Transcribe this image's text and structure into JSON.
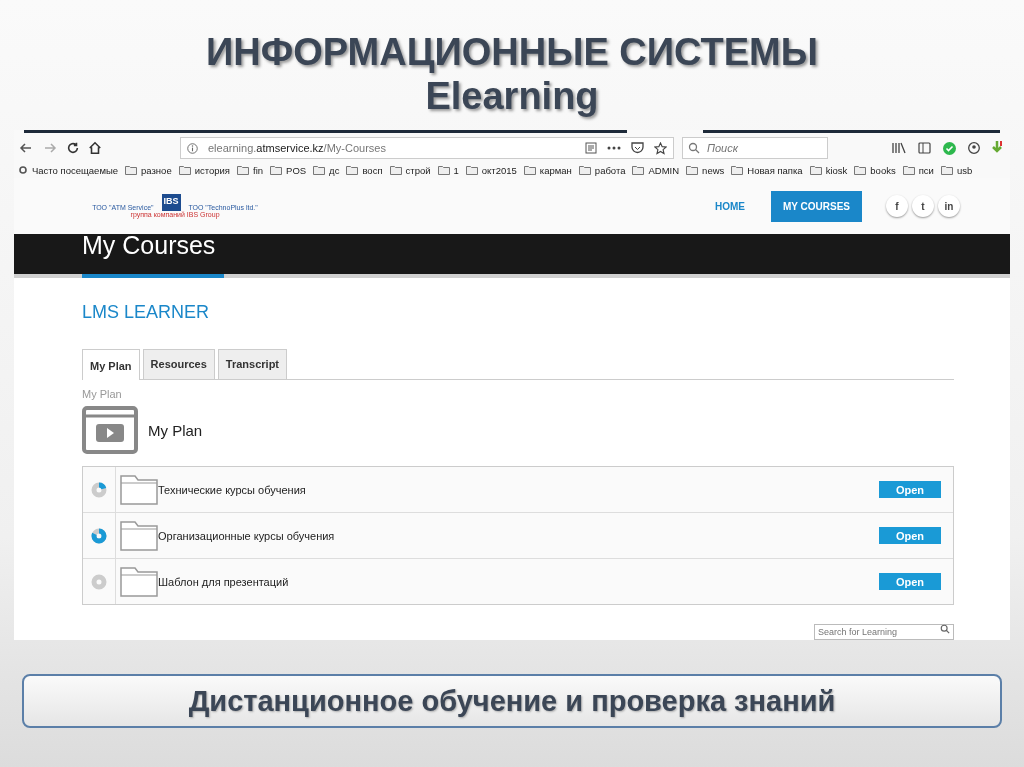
{
  "slide": {
    "title": "ИНФОРМАЦИОННЫЕ СИСТЕМЫ",
    "subtitle": "Elearning",
    "caption": "Дистанционное обучение и проверка знаний"
  },
  "browser": {
    "url_plain": "elearning.",
    "url_bold": "atmservice.kz",
    "url_path": "/My-Courses",
    "search": {
      "placeholder": "Поиск"
    },
    "bookmarks": [
      "Часто посещаемые",
      "разное",
      "история",
      "fin",
      "POS",
      "дс",
      "восп",
      "строй",
      "1",
      "окт2015",
      "карман",
      "работа",
      "ADMIN",
      "news",
      "Новая папка",
      "kiosk",
      "books",
      "пси",
      "usb"
    ]
  },
  "site": {
    "logo": {
      "left": "ТОО \"ATM Service\"",
      "mark": "IBS",
      "right": "ТОО \"TechnoPlus ltd.\"",
      "group": "группа компаний IBS Group"
    },
    "nav": [
      {
        "label": "HOME",
        "selected": false
      },
      {
        "label": "MY COURSES",
        "selected": true
      }
    ],
    "social": [
      "f",
      "t",
      "in"
    ],
    "banner": "My Courses",
    "heading": "LMS LEARNER",
    "tabs": [
      {
        "label": "My Plan",
        "selected": true
      },
      {
        "label": "Resources",
        "selected": false
      },
      {
        "label": "Transcript",
        "selected": false
      }
    ],
    "breadcrumb": "My Plan",
    "plan_title": "My Plan",
    "courses": [
      {
        "name": "Технические курсы обучения",
        "level": 0.2,
        "button": "Open"
      },
      {
        "name": "Организационные курсы обучения",
        "level": 0.8,
        "button": "Open"
      },
      {
        "name": "Шаблон для презентаций",
        "level": 0,
        "button": "Open"
      }
    ],
    "search": {
      "placeholder": "Search for Learning"
    }
  }
}
